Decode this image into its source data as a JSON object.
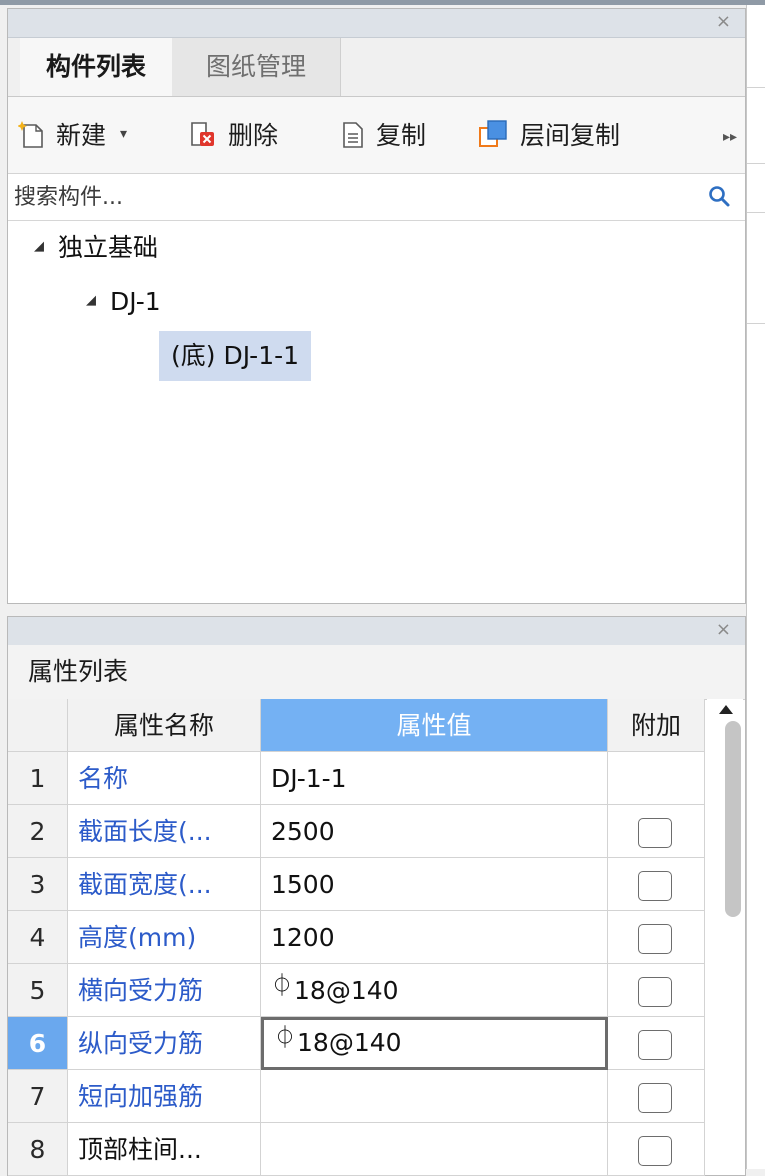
{
  "component_panel": {
    "close_glyph": "×",
    "tabs": [
      {
        "label": "构件列表",
        "active": true
      },
      {
        "label": "图纸管理",
        "active": false
      }
    ],
    "toolbar": {
      "new_label": "新建",
      "new_caret": "▾",
      "delete_label": "删除",
      "copy_label": "复制",
      "floor_copy_label": "层间复制",
      "more_glyph": "▸▸"
    },
    "search": {
      "placeholder": "搜索构件..."
    },
    "tree": {
      "root_label": "独立基础",
      "child_label": "DJ-1",
      "leaf_label": "(底) DJ-1-1",
      "expanded_glyph": "◢"
    }
  },
  "property_panel": {
    "close_glyph": "×",
    "title": "属性列表",
    "columns": {
      "name": "属性名称",
      "value": "属性值",
      "extra": "附加"
    },
    "rebar_symbol": "⏀",
    "rows": [
      {
        "num": "1",
        "name": "名称",
        "value": "DJ-1-1",
        "has_checkbox": false
      },
      {
        "num": "2",
        "name": "截面长度(...",
        "value": "2500",
        "has_checkbox": true
      },
      {
        "num": "3",
        "name": "截面宽度(...",
        "value": "1500",
        "has_checkbox": true
      },
      {
        "num": "4",
        "name": "高度(mm)",
        "value": "1200",
        "has_checkbox": true
      },
      {
        "num": "5",
        "name": "横向受力筋",
        "value": "18@140",
        "has_checkbox": true
      },
      {
        "num": "6",
        "name": "纵向受力筋",
        "value": "18@140",
        "has_checkbox": true,
        "selected": true
      },
      {
        "num": "7",
        "name": "短向加强筋",
        "value": "",
        "has_checkbox": true
      },
      {
        "num": "8",
        "name": "顶部柱间...",
        "value": "",
        "has_checkbox": true
      }
    ]
  },
  "colors": {
    "accent_blue": "#74b1f3",
    "selected_row": "#6aa8ee",
    "tree_selection": "#cfdbef",
    "property_name_text": "#2c5bc9"
  }
}
